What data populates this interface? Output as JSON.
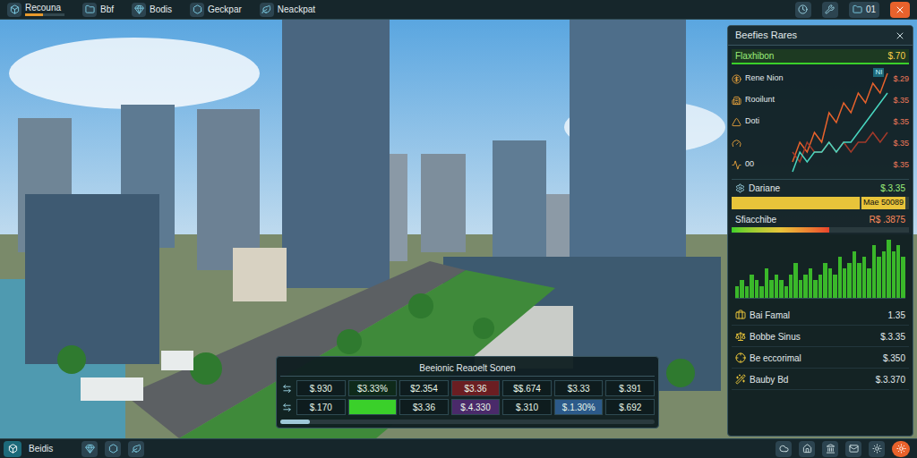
{
  "top_bar": {
    "tabs": [
      {
        "label": "Recouna",
        "level": 0.45
      },
      {
        "label": "Bbf",
        "level": 0
      },
      {
        "label": "Bodis",
        "level": 0
      },
      {
        "label": "Geckpar",
        "level": 0
      },
      {
        "label": "Neackpat",
        "level": 0
      }
    ],
    "counter": "01"
  },
  "finance_panel": {
    "title": "Beefies Rares",
    "highlight": {
      "label": "Flaxhibon",
      "value": "$.70"
    },
    "chart_rows": [
      {
        "label": "Rene Nion",
        "value": "$.29"
      },
      {
        "label": "Rooilunt",
        "value": "$.35"
      },
      {
        "label": "Doti",
        "value": "$.35"
      },
      {
        "label": "",
        "value": "$.35"
      },
      {
        "label": "00",
        "value": "$.35"
      }
    ],
    "chart": {
      "marker": "NI",
      "series": [
        {
          "color": "#e8622c",
          "values": [
            1,
            3,
            2,
            4,
            3,
            6,
            5,
            7,
            6,
            8,
            7,
            9,
            8,
            10
          ]
        },
        {
          "color": "#a33a2a",
          "values": [
            2,
            1,
            3,
            2,
            2,
            3,
            2,
            3,
            2,
            3,
            3,
            4,
            3,
            4
          ]
        },
        {
          "color": "#48d6c0",
          "values": [
            0,
            2,
            1,
            2,
            2,
            3,
            2,
            3,
            3,
            4,
            5,
            6,
            7,
            8
          ]
        }
      ]
    },
    "summary": {
      "label": "Dariane",
      "value": "$.3.35"
    },
    "bar_one": {
      "label": "Mae 50089",
      "level": 0.72
    },
    "bar_two": {
      "label": "Sfiacchibe",
      "value": "R$ .3875",
      "level": 0.55
    },
    "bar_chart": [
      2,
      3,
      2,
      4,
      3,
      2,
      5,
      3,
      4,
      3,
      2,
      4,
      6,
      3,
      4,
      5,
      3,
      4,
      6,
      5,
      4,
      7,
      5,
      6,
      8,
      6,
      7,
      5,
      9,
      7,
      8,
      10,
      8,
      9,
      7
    ],
    "rows": [
      {
        "label": "Bai Famal",
        "value": "1.35"
      },
      {
        "label": "Bobbe Sinus",
        "value": "$.3.35"
      },
      {
        "label": "Be eccorimal",
        "value": "$.350"
      },
      {
        "label": "Bauby Bd",
        "value": "$.3.370"
      }
    ]
  },
  "report_panel": {
    "title": "Beeionic Reaoelt Sonen",
    "level": 0.08,
    "rows": [
      [
        {
          "text": "$.930",
          "color": "#0e1c1e"
        },
        {
          "text": "$3.33%",
          "color": "#0f2a1a"
        },
        {
          "text": "$2.354",
          "color": "#0e1c1e"
        },
        {
          "text": "$3.36",
          "color": "#6b1e22"
        },
        {
          "text": "$$.674",
          "color": "#0e1c1e"
        },
        {
          "text": "$3.33",
          "color": "#0e1c1e"
        },
        {
          "text": "$.391",
          "color": "#0e1c1e"
        }
      ],
      [
        {
          "text": "$.170",
          "color": "#0e1c1e"
        },
        {
          "text": "",
          "color": "#3ad02a"
        },
        {
          "text": "$3.36",
          "color": "#0e1c1e"
        },
        {
          "text": "$.4.330",
          "color": "#4a2a6a"
        },
        {
          "text": "$.310",
          "color": "#0e1c1e"
        },
        {
          "text": "$.1.30%",
          "color": "#2c5a8a"
        },
        {
          "text": "$.692",
          "color": "#0e1c1e"
        }
      ]
    ]
  },
  "bottom_bar": {
    "label": "Beidis"
  }
}
